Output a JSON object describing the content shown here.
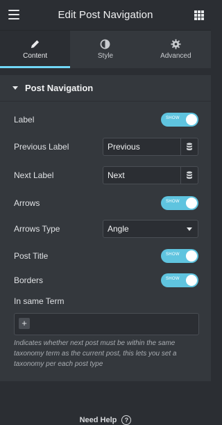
{
  "header": {
    "title": "Edit Post Navigation",
    "menu_icon": "hamburger-icon",
    "grid_icon": "apps-grid-icon"
  },
  "tabs": [
    {
      "label": "Content",
      "icon": "pencil-icon",
      "active": true
    },
    {
      "label": "Style",
      "icon": "half-circle-icon",
      "active": false
    },
    {
      "label": "Advanced",
      "icon": "gear-icon",
      "active": false
    }
  ],
  "section": {
    "title": "Post Navigation"
  },
  "controls": {
    "label": {
      "label": "Label",
      "toggle_text": "SHOW"
    },
    "previous_label": {
      "label": "Previous Label",
      "value": "Previous"
    },
    "next_label": {
      "label": "Next Label",
      "value": "Next"
    },
    "arrows": {
      "label": "Arrows",
      "toggle_text": "SHOW"
    },
    "arrows_type": {
      "label": "Arrows Type",
      "value": "Angle"
    },
    "post_title": {
      "label": "Post Title",
      "toggle_text": "SHOW"
    },
    "borders": {
      "label": "Borders",
      "toggle_text": "SHOW"
    },
    "in_same_term": {
      "label": "In same Term",
      "add_symbol": "+",
      "description": "Indicates whether next post must be within the same taxonomy term as the current post, this lets you set a taxonomy per each post type"
    }
  },
  "footer": {
    "help_text": "Need Help",
    "help_icon": "?"
  },
  "colors": {
    "accent": "#71d7f7",
    "toggle_on": "#5fc4df",
    "panel_bg": "#34383d",
    "page_bg": "#2b2e33"
  }
}
